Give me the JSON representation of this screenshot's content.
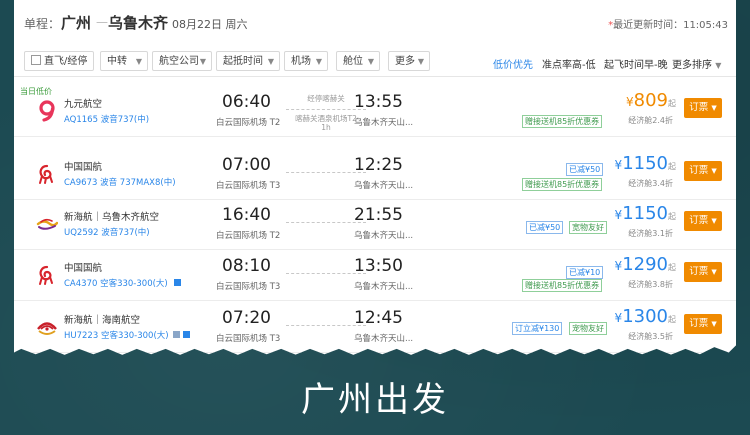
{
  "route": {
    "label": "单程：",
    "from": "广州",
    "sep": "—",
    "to": "乌鲁木齐",
    "date": "08月22日 周六",
    "last_update": "最近更新时间：11:05:43"
  },
  "filters": {
    "direct": "直飞/经停",
    "transfer": "中转",
    "airline": "航空公司",
    "time": "起抵时间",
    "airport": "机场",
    "cabin": "舱位",
    "more": "更多"
  },
  "sorts": {
    "low_price": "低价优先",
    "punctuality": "准点率高-低",
    "departure": "起飞时间早-晚",
    "more": "更多排序"
  },
  "lowest_tag": "当日低价",
  "flights": [
    {
      "airline": "九元航空",
      "flight_no": "AQ1165 波音737(中)",
      "dep_time": "06:40",
      "dep_airport": "白云国际机场 T2",
      "stop": "经停喀赫关",
      "stop_airport": "喀赫关酒泉机场T2",
      "stop_duration": "1h",
      "arr_time": "13:55",
      "arr_airport": "乌鲁木齐天山...",
      "promo1": "",
      "promo2": "赠接送机85折优惠券",
      "price_yen": "¥",
      "price": "809",
      "price_suffix": "起",
      "cabin": "经济舱2.4折",
      "book": "订票",
      "price_color": "#f08a00"
    },
    {
      "airline": "中国国航",
      "flight_no": "CA9673 波音 737MAX8(中)",
      "dep_time": "07:00",
      "dep_airport": "白云国际机场 T3",
      "arr_time": "12:25",
      "arr_airport": "乌鲁木齐天山...",
      "promo1": "已减¥50",
      "promo2": "赠接送机85折优惠券",
      "price_yen": "¥",
      "price": "1150",
      "price_suffix": "起",
      "cabin": "经济舱3.4折",
      "book": "订票"
    },
    {
      "airline": "新海航｜乌鲁木齐航空",
      "flight_no": "UQ2592 波音737(中)",
      "dep_time": "16:40",
      "dep_airport": "白云国际机场 T2",
      "arr_time": "21:55",
      "arr_airport": "乌鲁木齐天山...",
      "promo1": "已减¥50",
      "promo2": "宽物友好",
      "price_yen": "¥",
      "price": "1150",
      "price_suffix": "起",
      "cabin": "经济舱3.1折",
      "book": "订票"
    },
    {
      "airline": "中国国航",
      "flight_no": "CA4370 空客330-300(大)",
      "dep_time": "08:10",
      "dep_airport": "白云国际机场 T3",
      "arr_time": "13:50",
      "arr_airport": "乌鲁木齐天山...",
      "promo1": "已减¥10",
      "promo2": "赠接送机85折优惠券",
      "price_yen": "¥",
      "price": "1290",
      "price_suffix": "起",
      "cabin": "经济舱3.8折",
      "book": "订票"
    },
    {
      "airline": "新海航｜海南航空",
      "flight_no": "HU7223 空客330-300(大)",
      "dep_time": "07:20",
      "dep_airport": "白云国际机场 T3",
      "arr_time": "12:45",
      "arr_airport": "乌鲁木齐天山...",
      "promo1": "订立减¥130",
      "promo2": "宠物友好",
      "price_yen": "¥",
      "price": "1300",
      "price_suffix": "起",
      "cabin": "经济舱3.5折",
      "book": "订票"
    }
  ],
  "footer_title": "广州出发",
  "colors": {
    "background": "#1c4a52",
    "accent_blue": "#2a86e8",
    "book_orange": "#f08a00",
    "promo_green": "#3f9a4e"
  }
}
